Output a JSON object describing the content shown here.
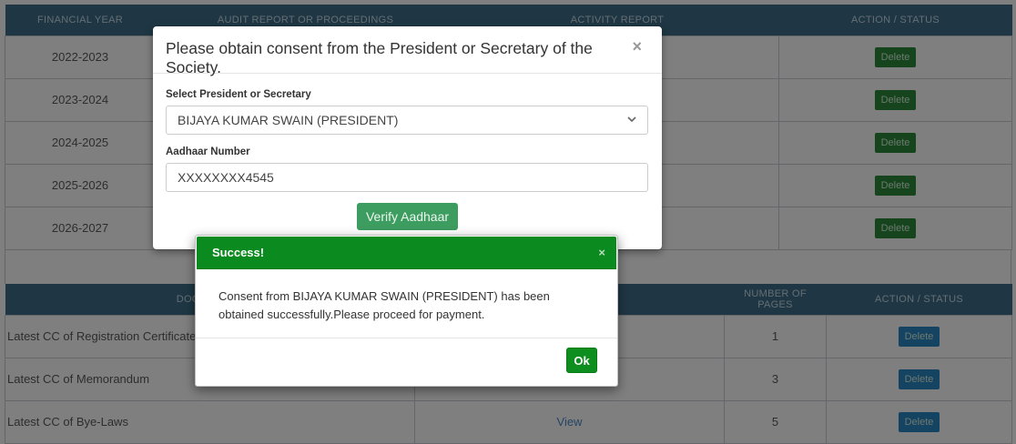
{
  "table1": {
    "headers": [
      "FINANCIAL YEAR",
      "AUDIT REPORT OR PROCEEDINGS",
      "ACTIVITY REPORT",
      "ACTION / STATUS"
    ],
    "rows": [
      {
        "year": "2022-2023",
        "action": "Delete"
      },
      {
        "year": "2023-2024",
        "action": "Delete"
      },
      {
        "year": "2024-2025",
        "action": "Delete"
      },
      {
        "year": "2025-2026",
        "action": "Delete"
      },
      {
        "year": "2026-2027",
        "action": "Delete"
      }
    ]
  },
  "table2": {
    "headers": [
      "DOCUMENTS",
      "",
      "NUMBER OF PAGES",
      "ACTION / STATUS"
    ],
    "rows": [
      {
        "doc": "Latest CC of Registration Certificate",
        "view": "",
        "pages": "1",
        "action": "Delete"
      },
      {
        "doc": "Latest CC of Memorandum",
        "view": "",
        "pages": "3",
        "action": "Delete"
      },
      {
        "doc": "Latest CC of Bye-Laws",
        "view": "View",
        "pages": "5",
        "action": "Delete"
      }
    ]
  },
  "consent_modal": {
    "title": "Please obtain consent from the President or Secretary of the Society.",
    "close": "×",
    "select_label": "Select President or Secretary",
    "select_value": "BIJAYA KUMAR SWAIN (PRESIDENT)",
    "aadhaar_label": "Aadhaar Number",
    "aadhaar_value": "XXXXXXXX4545",
    "verify_button": "Verify Aadhaar"
  },
  "success_modal": {
    "title": "Success!",
    "close": "×",
    "message": "Consent from BIJAYA KUMAR SWAIN (PRESIDENT) has been obtained successfully.Please proceed for payment.",
    "ok_button": "Ok"
  },
  "colors": {
    "header_bg": "#3f6e88",
    "success_green": "#0a8a1f",
    "verify_green": "#3d9c5f"
  }
}
